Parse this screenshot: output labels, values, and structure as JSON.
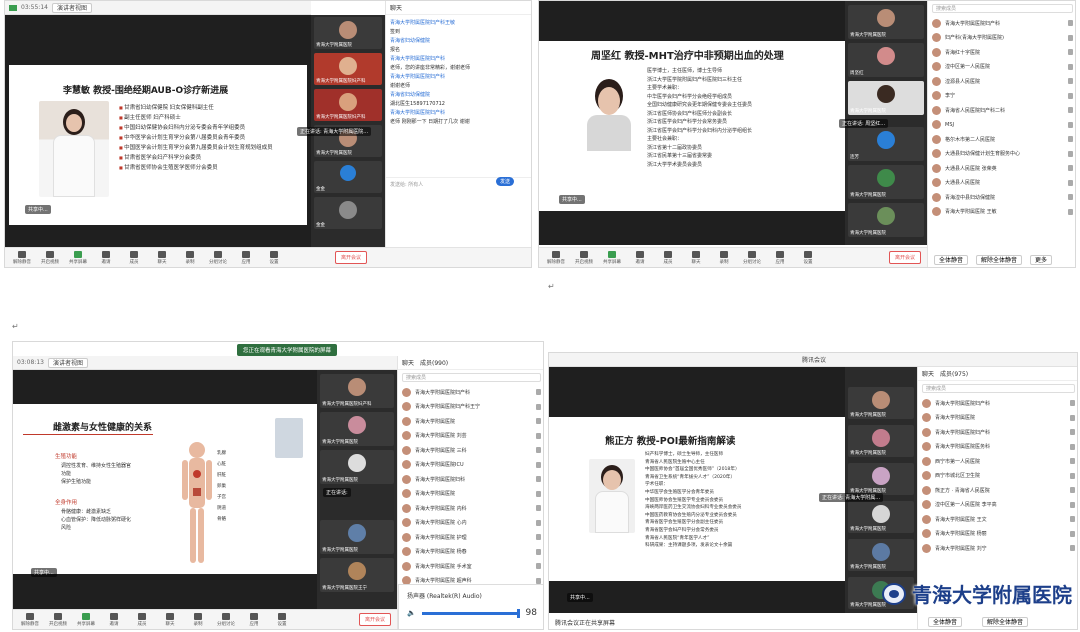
{
  "common": {
    "end_meeting": "离开会议",
    "bottom_items": [
      "解除静音",
      "开启视频",
      "共享屏幕",
      "邀请",
      "成员",
      "聊天",
      "录制",
      "分组讨论",
      "应用",
      "设置"
    ]
  },
  "s1": {
    "time": "03:55:14",
    "view_btn": "演讲者视图",
    "chat_tab": "聊天",
    "slide_title": "李慧敏 教授-围绝经期AUB-O诊疗新进展",
    "bullets": [
      "甘肃省妇幼保健院 妇女保健科副主任",
      "副主任医师 妇产科硕士",
      "中国妇幼保健协会妇科内分泌专委会青年学组委员",
      "中华医学会计划生育学分会第八届委员会青年委员",
      "中国医学会计划生育学分会第九届委员会计划生育规划组成员",
      "甘肃省医学会妇产科学分会委员",
      "甘肃省医师协会生殖医学医师分会委员"
    ],
    "speaker": "正在讲话: 青海大学附属医院...",
    "chat": [
      {
        "who": "青海大学附属医院妇产科王敏",
        "msg": "签到"
      },
      {
        "who": "青海省妇幼保健院",
        "msg": "报名"
      },
      {
        "who": "青海大学附属医院妇产科",
        "msg": "老师，您的讲座非常精彩，谢谢老师"
      },
      {
        "who": "青海大学附属医院妇产科",
        "msg": "谢谢老师"
      },
      {
        "who": "青海省妇幼保健院",
        "msg": "湖北医生15897170712"
      },
      {
        "who": "青海大学附属医院妇产科",
        "msg": "老师 刚刚那一下 日期打了几次 谢谢"
      }
    ],
    "chat_input": "发送给: 所有人",
    "send": "发送",
    "tiles": [
      "青海大学附属医院",
      "青海大学附属医院妇产科",
      "青海大学附属医院妇产科",
      "青海大学附属医院",
      "金金",
      "金金"
    ]
  },
  "s2": {
    "title": "周坚红 教授-MHT治疗中非预期出血的处理",
    "search": "搜索成员",
    "bio": [
      "医学博士，主任医师，博士生导师",
      "浙江大学医学院附属妇产科医院妇三科主任",
      "主要学术兼职：",
      "中华医学会妇产科学分会绝经学组成员",
      "全国妇幼健康研究会更年期保健专委会主任委员",
      "浙江省医师协会妇产科医师分会副会长",
      "浙江省医学会妇产科学分会常务委员",
      "浙江省医学会妇产科学分会妇科内分泌学组组长",
      "主要社会兼职：",
      "浙江省第十二届政协委员",
      "浙江省民革第十三届省委常委",
      "浙江大学学术委员会委员"
    ],
    "speaker": "正在讲话: 周坚红...",
    "tiles": [
      "青海大学附属医院",
      "周坚红",
      "青海大学附属医院",
      "连芳",
      "青海大学附属医院",
      "青海大学附属医院"
    ],
    "members": [
      "青海大学附属医院妇产科",
      "妇产科(青海大学附属医院)",
      "青海红十字医院",
      "湟中区第一人民医院",
      "湟源县人民医院",
      "李宁",
      "青海省人民医院妇产科二科",
      "MSJ",
      "格尔木市第二人民医院",
      "大通县妇幼保健计划生育服务中心",
      "大通县人民医院 张荣英",
      "大通县人民医院",
      "青海湟中县妇幼保健院",
      "青海大学附属医院 王敏"
    ],
    "bottom": [
      "全体静音",
      "解除全体静音",
      "更多"
    ]
  },
  "s3": {
    "banner": "您正在观看青海大学附属医院的屏幕",
    "time": "03:08:13",
    "view_btn": "演讲者视图",
    "slide_title": "雌激素与女性健康的关系",
    "section1": "生殖功能",
    "s1_items": [
      "调控性发育、维持女性生殖器官功能",
      "保护生殖功能"
    ],
    "section2": "全身作用",
    "s2_items": [
      "骨骼健康：雌激素缺乏",
      "心血管保护：降低动脉粥样硬化风险"
    ],
    "organ_labels": [
      "乳腺",
      "心脏",
      "肝脏",
      "卵巢",
      "子宫",
      "阴道",
      "骨骼"
    ],
    "speaker": "正在讲话:",
    "tiles": [
      "青海大学附属医院妇产科",
      "青海大学附属医院",
      "青海大学附属医院",
      "青海大学附属医院",
      "青海大学附属医院王宁"
    ],
    "panel_head": "聊天",
    "members_title": "成员(990)",
    "search": "搜索成员",
    "members": [
      "青海大学附属医院妇产科",
      "青海大学附属医院妇产科王宁",
      "青海大学附属医院",
      "青海大学附属医院 刘芸",
      "青海大学附属医院 三科",
      "青海大学附属医院ICU",
      "青海大学附属医院妇科",
      "青海大学附属医院",
      "青海大学附属医院 内科",
      "青海大学附属医院 心内",
      "青海大学附属医院 护理",
      "青海大学附属医院 杨春",
      "青海大学附属医院 手术室",
      "青海大学附属医院 超声科"
    ],
    "audio_label": "扬声器 (Realtek(R) Audio)",
    "volume": "98"
  },
  "s4": {
    "meeting": "腾讯会议",
    "title": "熊正方 教授-POI最新指南解读",
    "bio": [
      "妇产科学博士，硕士生导师，主任医师",
      "青海省人民医院生殖中心主任",
      "中国医师协会“首届全国优秀医师”（2018年）",
      "青海省卫生系统“青年拔尖人才”（2020年）",
      "学术任职：",
      "中华医学会生殖医学分会青年委员",
      "中国医师协会生殖医学专业委员会委员",
      "海峡两岸医药卫生交流协会妇科专业委员会委员",
      "中国医药教育协会生殖内分泌专业委员会委员",
      "青海省医学会生殖医学分会副主任委员",
      "青海省医学会妇产科学分会常务委员",
      "青海省人民医院“青年医学人才”",
      "科研成果：主持课题多项，发表论文十余篇"
    ],
    "speaker": "正在讲话: 青海大学附属...",
    "tiles": [
      "青海大学附属医院",
      "青海大学附属医院",
      "青海大学附属医院",
      "青海大学附属医院",
      "青海大学附属医院",
      "青海大学附属医院"
    ],
    "panel_head": "聊天",
    "members_title": "成员(975)",
    "search": "搜索成员",
    "members": [
      "青海大学附属医院妇产科",
      "青海大学附属医院",
      "青海大学附属医院妇产科",
      "青海大学附属医院医务科",
      "西宁市第一人民医院",
      "西宁市城北区卫生院",
      "熊正方 · 青海省人民医院",
      "湟中区第一人民医院 李平高",
      "青海大学附属医院 王文",
      "青海大学附属医院 杨丽",
      "青海大学附属医院 刘宁"
    ],
    "bottom_notice": "腾讯会议正在共享屏幕",
    "bottom": [
      "全体静音",
      "解除全体静音"
    ]
  },
  "watermark": "青海大学附属医院"
}
